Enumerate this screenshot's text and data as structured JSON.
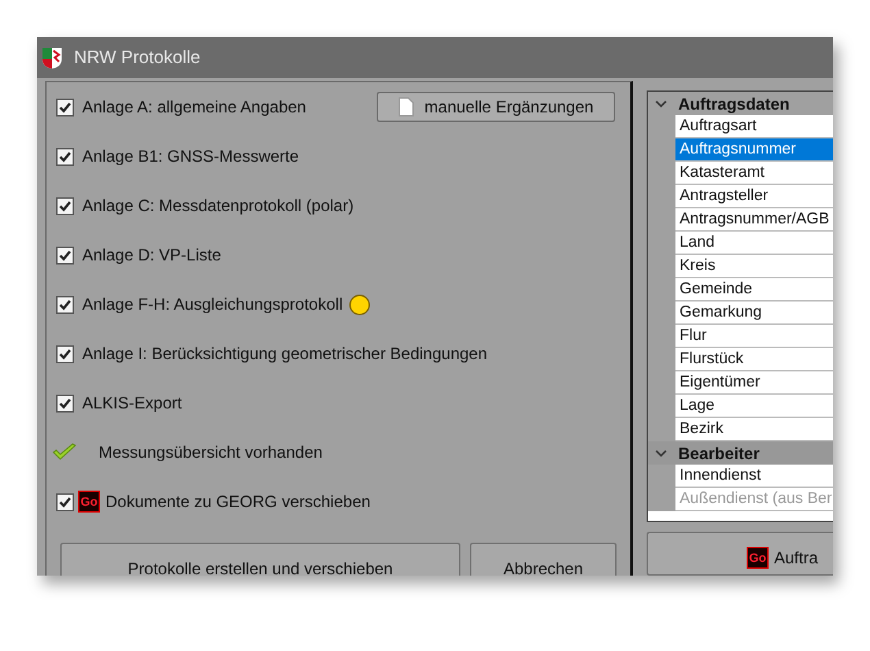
{
  "window": {
    "title": "NRW Protokolle"
  },
  "manual_button": {
    "label": "manuelle Ergänzungen"
  },
  "options": [
    {
      "kind": "checkbox",
      "label": "Anlage A: allgemeine Angaben",
      "checked": true
    },
    {
      "kind": "checkbox",
      "label": "Anlage B1: GNSS-Messwerte",
      "checked": true
    },
    {
      "kind": "checkbox",
      "label": "Anlage C: Messdatenprotokoll (polar)",
      "checked": true
    },
    {
      "kind": "checkbox",
      "label": "Anlage D: VP-Liste",
      "checked": true
    },
    {
      "kind": "checkbox",
      "label": "Anlage F-H: Ausgleichungsprotokoll",
      "checked": true,
      "color": "#ffd400"
    },
    {
      "kind": "checkbox",
      "label": "Anlage I: Berücksichtigung geometrischer Bedingungen",
      "checked": true
    },
    {
      "kind": "checkbox",
      "label": "ALKIS-Export",
      "checked": true
    },
    {
      "kind": "status",
      "label": "Messungsübersicht vorhanden"
    },
    {
      "kind": "checkbox",
      "label": "Dokumente zu GEORG verschieben",
      "checked": true,
      "badge": "Go"
    }
  ],
  "buttons": [
    {
      "label": "Protokolle erstellen und verschieben"
    },
    {
      "label": "Abbrechen"
    }
  ],
  "tree": [
    {
      "label": "Auftragsdaten",
      "expanded": true,
      "children": [
        {
          "label": "Auftragsart",
          "selected": false,
          "disabled": false
        },
        {
          "label": "Auftragsnummer",
          "selected": true,
          "disabled": false
        },
        {
          "label": "Katasteramt",
          "selected": false,
          "disabled": false
        },
        {
          "label": "Antragsteller",
          "selected": false,
          "disabled": false
        },
        {
          "label": "Antragsnummer/AGB",
          "selected": false,
          "disabled": false
        },
        {
          "label": "Land",
          "selected": false,
          "disabled": false
        },
        {
          "label": "Kreis",
          "selected": false,
          "disabled": false
        },
        {
          "label": "Gemeinde",
          "selected": false,
          "disabled": false
        },
        {
          "label": "Gemarkung",
          "selected": false,
          "disabled": false
        },
        {
          "label": "Flur",
          "selected": false,
          "disabled": false
        },
        {
          "label": "Flurstück",
          "selected": false,
          "disabled": false
        },
        {
          "label": "Eigentümer",
          "selected": false,
          "disabled": false
        },
        {
          "label": "Lage",
          "selected": false,
          "disabled": false
        },
        {
          "label": "Bezirk",
          "selected": false,
          "disabled": false
        }
      ]
    },
    {
      "label": "Bearbeiter",
      "expanded": true,
      "children": [
        {
          "label": "Innendienst",
          "selected": false,
          "disabled": false
        },
        {
          "label": "Außendienst (aus Ber",
          "selected": false,
          "disabled": true
        }
      ]
    }
  ],
  "side_button": {
    "badge": "Go",
    "label": "Auftra"
  }
}
